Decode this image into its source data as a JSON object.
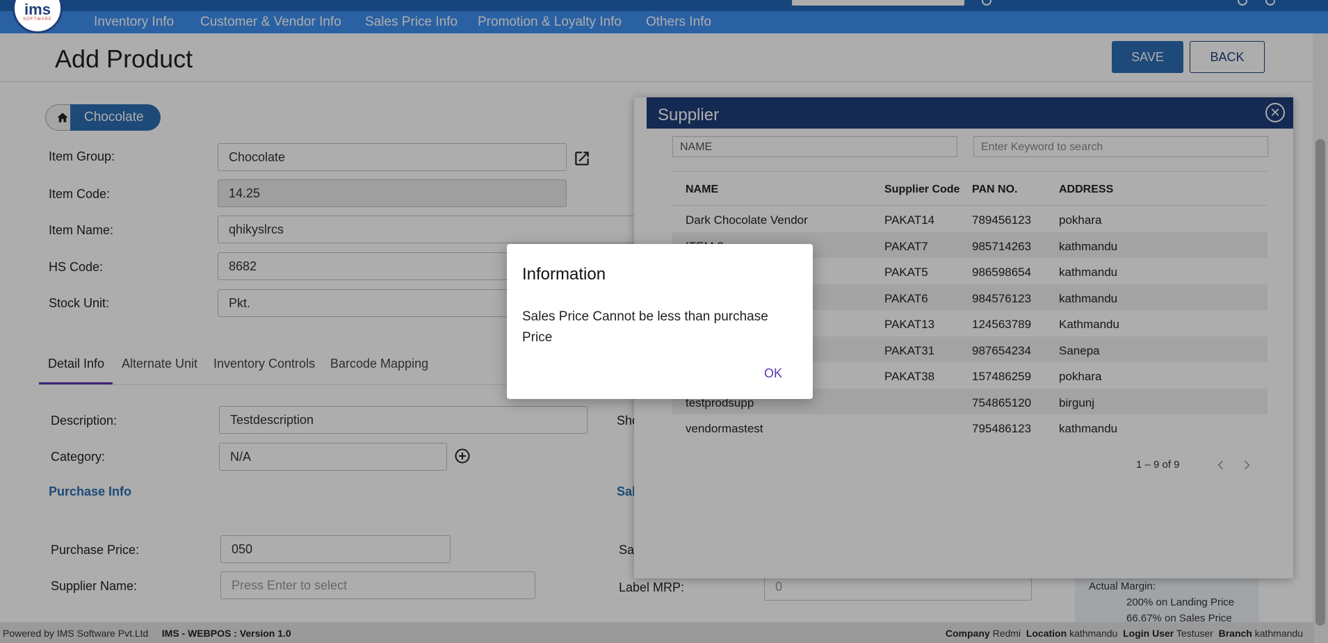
{
  "app": {
    "logo_text": "ims",
    "logo_sub": "SOFTWARE"
  },
  "nav": {
    "items": [
      "Inventory Info",
      "Customer & Vendor Info",
      "Sales Price Info",
      "Promotion & Loyalty Info",
      "Others Info"
    ]
  },
  "header": {
    "title": "Add Product",
    "save_label": "SAVE",
    "back_label": "BACK"
  },
  "breadcrumb": {
    "current": "Chocolate"
  },
  "form": {
    "item_group_label": "Item Group:",
    "item_group_value": "Chocolate",
    "item_code_label": "Item Code:",
    "item_code_value": "14.25",
    "item_name_label": "Item Name:",
    "item_name_value": "qhikyslrcs",
    "hs_code_label": "HS Code:",
    "hs_code_value": "8682",
    "stock_unit_label": "Stock Unit:",
    "stock_unit_value": "Pkt."
  },
  "tabs": [
    "Detail Info",
    "Alternate Unit",
    "Inventory Controls",
    "Barcode Mapping"
  ],
  "detail": {
    "description_label": "Description:",
    "description_value": "Testdescription",
    "category_label": "Category:",
    "category_value": "N/A",
    "short_label_partial": "Sho",
    "purchase_section": "Purchase Info",
    "sales_section_partial": "Sal",
    "purchase_price_label": "Purchase Price:",
    "purchase_price_value": "050",
    "sales_price_label_partial": "Sa",
    "supplier_name_label": "Supplier Name:",
    "supplier_name_placeholder": "Press Enter to select",
    "label_mrp_label": "Label MRP:",
    "label_mrp_value": "0"
  },
  "margin": {
    "title": "Actual Margin:",
    "landing": "200% on Landing Price",
    "sales": "66.67% on Sales Price"
  },
  "supplier_modal": {
    "title": "Supplier",
    "filter_field": "NAME",
    "search_placeholder": "Enter Keyword to search",
    "columns": [
      "NAME",
      "Supplier Code",
      "PAN NO.",
      "ADDRESS"
    ],
    "rows": [
      [
        "Dark Chocolate Vendor",
        "PAKAT14",
        "789456123",
        "pokhara"
      ],
      [
        "ITEM 3",
        "PAKAT7",
        "985714263",
        "kathmandu"
      ],
      [
        "",
        "PAKAT5",
        "986598654",
        "kathmandu"
      ],
      [
        "",
        "PAKAT6",
        "984576123",
        "kathmandu"
      ],
      [
        "",
        "PAKAT13",
        "124563789",
        "Kathmandu"
      ],
      [
        "",
        "PAKAT31",
        "987654234",
        "Sanepa"
      ],
      [
        "",
        "PAKAT38",
        "157486259",
        "pokhara"
      ],
      [
        "testprodsupp",
        "",
        "754865120",
        "birgunj"
      ],
      [
        "vendormastest",
        "",
        "795486123",
        "kathmandu"
      ]
    ],
    "pager_text": "1 – 9 of 9"
  },
  "dialog": {
    "title": "Information",
    "message": "Sales Price Cannot be less than purchase Price",
    "ok_label": "OK"
  },
  "footer": {
    "powered": "Powered by IMS Software Pvt.Ltd",
    "version": "IMS - WEBPOS : Version 1.0",
    "company_label": "Company",
    "company_value": "Redmi",
    "location_label": "Location",
    "location_value": "kathmandu",
    "user_label": "Login User",
    "user_value": "Testuser",
    "branch_label": "Branch",
    "branch_value": "kathmandu"
  },
  "colors": {
    "nav_bar": "#3e8ff0",
    "top_bar": "#1f66b5",
    "brand_dark": "#1f3f7a",
    "accent_purple": "#5e35b1"
  }
}
